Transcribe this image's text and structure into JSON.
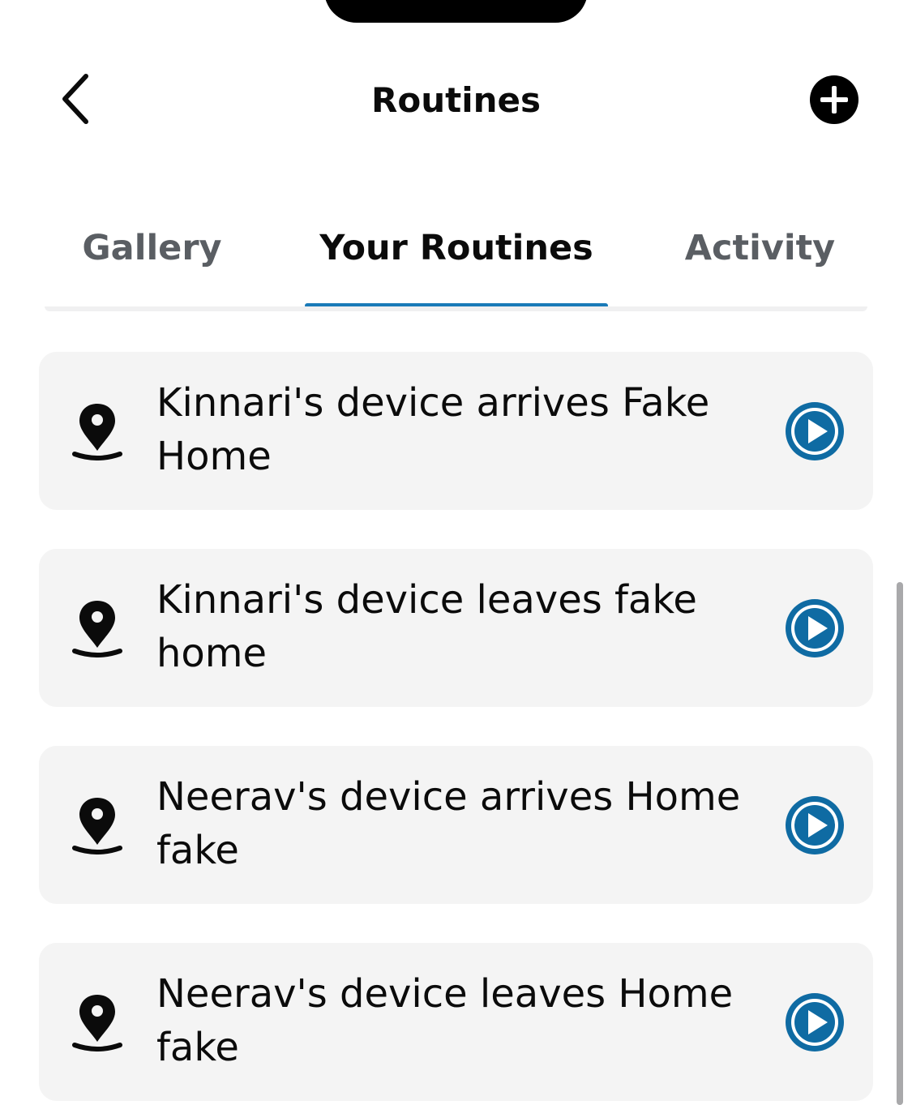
{
  "header": {
    "title": "Routines",
    "back_icon": "chevron-left-icon",
    "add_icon": "plus-circle-icon"
  },
  "tabs": [
    {
      "label": "Gallery",
      "active": false
    },
    {
      "label": "Your Routines",
      "active": true
    },
    {
      "label": "Activity",
      "active": false
    }
  ],
  "routines": [
    {
      "name": "Kinnari's device arrives Fake Home",
      "icon": "location-pin-icon",
      "action_icon": "play-icon"
    },
    {
      "name": "Kinnari's device leaves fake home",
      "icon": "location-pin-icon",
      "action_icon": "play-icon"
    },
    {
      "name": "Neerav's device arrives Home fake",
      "icon": "location-pin-icon",
      "action_icon": "play-icon"
    },
    {
      "name": "Neerav's device leaves Home fake",
      "icon": "location-pin-icon",
      "action_icon": "play-icon"
    }
  ],
  "colors": {
    "accent": "#1a7ab8",
    "play_button": "#0f6ba3",
    "card_background": "#f4f4f4",
    "inactive_tab": "#5a5e63"
  }
}
